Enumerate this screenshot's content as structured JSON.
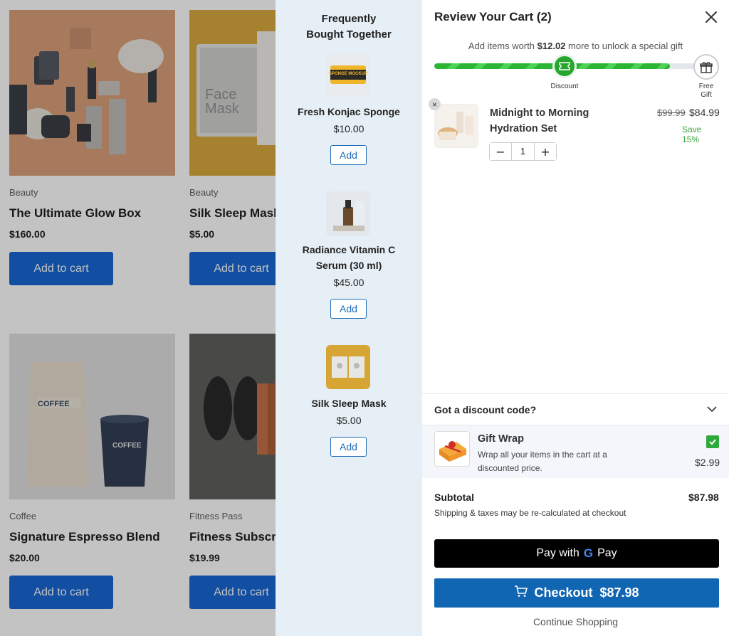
{
  "products": [
    {
      "category": "Beauty",
      "name": "The Ultimate Glow Box",
      "price": "$160.00",
      "button": "Add to cart"
    },
    {
      "category": "Beauty",
      "name": "Silk Sleep Mask",
      "price": "$5.00",
      "button": "Add to cart"
    },
    {
      "category": "Coffee",
      "name": "Signature Espresso Blend",
      "price": "$20.00",
      "button": "Add to cart"
    },
    {
      "category": "Fitness Pass",
      "name": "Fitness Subscription",
      "price": "$19.99",
      "button": "Add to cart"
    }
  ],
  "fbt": {
    "title": "Frequently Bought Together",
    "items": [
      {
        "name": "Fresh Konjac Sponge",
        "price": "$10.00",
        "button": "Add",
        "thumb_text": "SPONGE MOCKUP"
      },
      {
        "name": "Radiance Vitamin C Serum (30 ml)",
        "price": "$45.00",
        "button": "Add"
      },
      {
        "name": "Silk Sleep Mask",
        "price": "$5.00",
        "button": "Add"
      }
    ]
  },
  "cart": {
    "title": "Review Your Cart (2)",
    "progress": {
      "prefix": "Add items worth ",
      "amount": "$12.02",
      "suffix": " more to unlock a special gift",
      "fill_fraction": 0.87,
      "milestones": [
        {
          "label": "Discount"
        },
        {
          "label": "Free Gift"
        }
      ]
    },
    "line_item": {
      "name": "Midnight to Morning Hydration Set",
      "old_price": "$99.99",
      "new_price": "$84.99",
      "save": "Save 15%",
      "quantity": "1",
      "remove": "×",
      "minus": "−",
      "plus": "+"
    },
    "discount_label": "Got a discount code?",
    "gift_wrap": {
      "title": "Gift Wrap",
      "description": "Wrap all your items in the cart at a discounted price.",
      "price": "$2.99",
      "checked": true
    },
    "subtotal_label": "Subtotal",
    "subtotal_value": "$87.98",
    "shipping_note": "Shipping & taxes may be re-calculated at checkout",
    "gpay_prefix": "Pay with",
    "gpay_g": "G",
    "gpay_suffix": "Pay",
    "checkout_label": "Checkout  $87.98",
    "continue_label": "Continue Shopping"
  },
  "colors": {
    "accent": "#1166b3",
    "shop_button": "#0b5fd1",
    "progress_green": "#2bb532",
    "save_green": "#3aa53f",
    "fbt_bg": "#e6eff5"
  }
}
